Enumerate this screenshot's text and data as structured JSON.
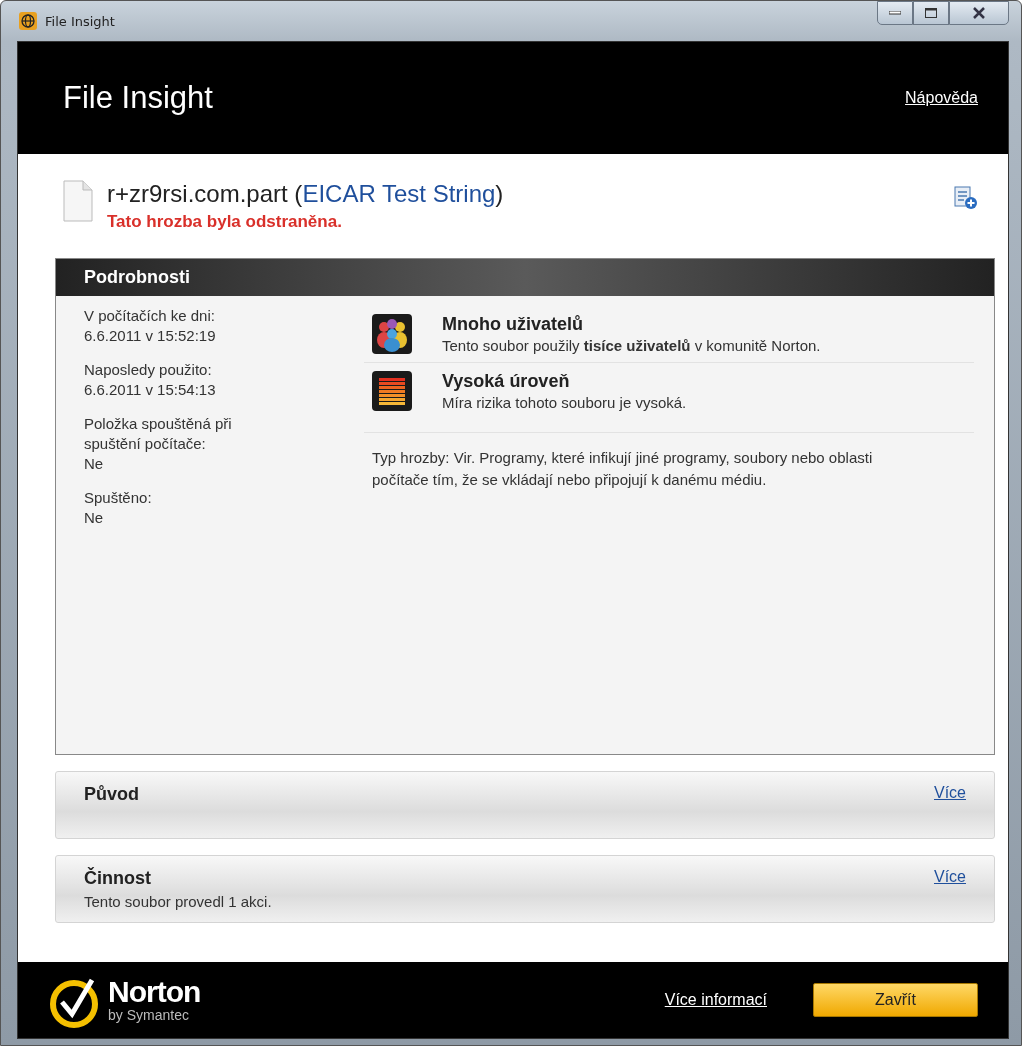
{
  "window": {
    "title": "File Insight"
  },
  "header": {
    "title": "File Insight",
    "help_link": "Nápověda"
  },
  "file": {
    "name_prefix": "r+zr9rsi.com.part (",
    "threat_link": "EICAR Test String",
    "name_suffix": ")",
    "status": "Tato hrozba byla odstraněna."
  },
  "details": {
    "title": "Podrobnosti",
    "facts": [
      {
        "label": "V počítačích ke dni:",
        "value": "6.6.2011 v 15:52:19"
      },
      {
        "label": "Naposledy použito:",
        "value": "6.6.2011 v 15:54:13"
      },
      {
        "label": "Položka spouštěná při spuštění počítače:",
        "value": "Ne"
      },
      {
        "label": "Spuštěno:",
        "value": "Ne"
      }
    ],
    "ratings": [
      {
        "kind": "users",
        "title": "Mnoho uživatelů",
        "description": "Tento soubor použily **tisíce uživatelů** v komunitě Norton."
      },
      {
        "kind": "risk",
        "title": "Vysoká úroveň",
        "description": "Míra rizika tohoto souboru je vysoká."
      }
    ],
    "threat_type": "Typ hrozby: Vir. Programy, které infikují jiné programy, soubory nebo oblasti počítače tím, že se vkládají nebo připojují k danému médiu."
  },
  "sections": [
    {
      "title": "Původ",
      "link": "Více"
    },
    {
      "title": "Činnost",
      "link": "Více",
      "summary": "Tento soubor provedl 1 akci."
    }
  ],
  "footer": {
    "brand": "Norton",
    "brand_sub": "by Symantec",
    "link": "Více informací",
    "button": "Zavřít"
  }
}
